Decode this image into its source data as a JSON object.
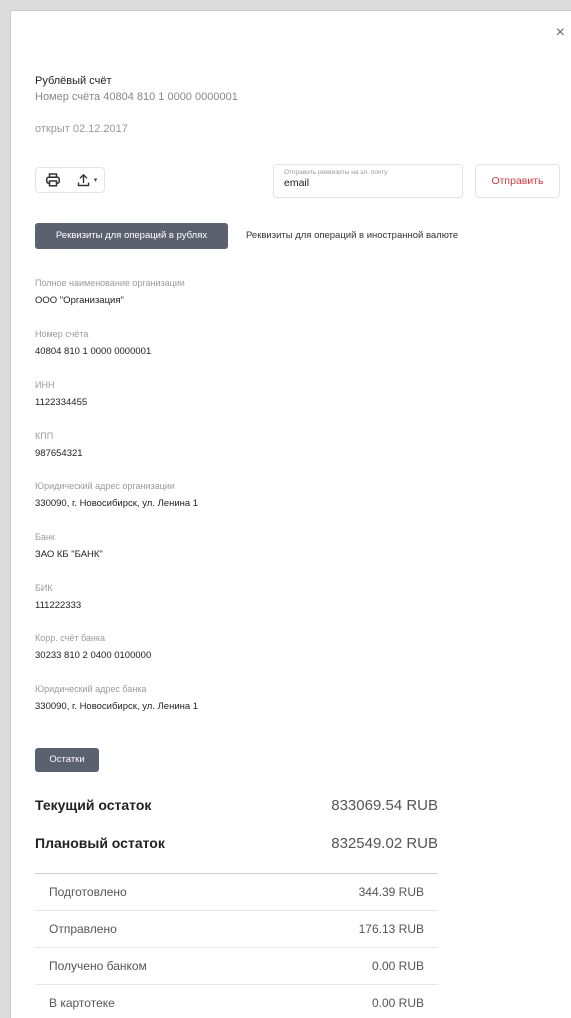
{
  "header": {
    "close_glyph": "×",
    "account_title": "Рублёвый счёт",
    "account_number": "Номер счёта 40804 810 1 0000 0000001",
    "opened": "открыт 02.12.2017"
  },
  "toolbar": {
    "icons": [
      "printer-icon",
      "upload-icon",
      "caret-down-icon"
    ],
    "caret_glyph": "▾"
  },
  "email_form": {
    "label": "Отправить реквизиты на эл. почту",
    "value": "email",
    "send_label": "Отправить"
  },
  "tabs": [
    {
      "label": "Реквизиты для операций в рублях",
      "active": true
    },
    {
      "label": "Реквизиты для операций в иностранной валюте",
      "active": false
    }
  ],
  "fields": [
    {
      "label": "Полное наименование организации",
      "value": "ООО \"Организация\""
    },
    {
      "label": "Номер счёта",
      "value": "40804 810 1 0000 0000001"
    },
    {
      "label": "ИНН",
      "value": "1122334455"
    },
    {
      "label": "КПП",
      "value": "987654321"
    },
    {
      "label": "Юридический адрес организации",
      "value": "330090, г. Новосибирск, ул. Ленина 1"
    },
    {
      "label": "Банк",
      "value": "ЗАО КБ \"БАНК\""
    },
    {
      "label": "БИК",
      "value": "111222333"
    },
    {
      "label": "Корр. счёт банка",
      "value": "30233 810 2 0400 0100000"
    },
    {
      "label": "Юридический адрес банка",
      "value": "330090, г. Новосибирск, ул. Ленина 1"
    }
  ],
  "balances": {
    "button_label": "Остатки",
    "current_label": "Текущий остаток",
    "current_value": "833069.54 RUB",
    "planned_label": "Плановый остаток",
    "planned_value": "832549.02 RUB",
    "rows": [
      {
        "label": "Подготовлено",
        "value": "344.39 RUB"
      },
      {
        "label": "Отправлено",
        "value": "176.13 RUB"
      },
      {
        "label": "Получено банком",
        "value": "0.00 RUB"
      },
      {
        "label": "В картотеке",
        "value": "0.00 RUB"
      }
    ]
  }
}
